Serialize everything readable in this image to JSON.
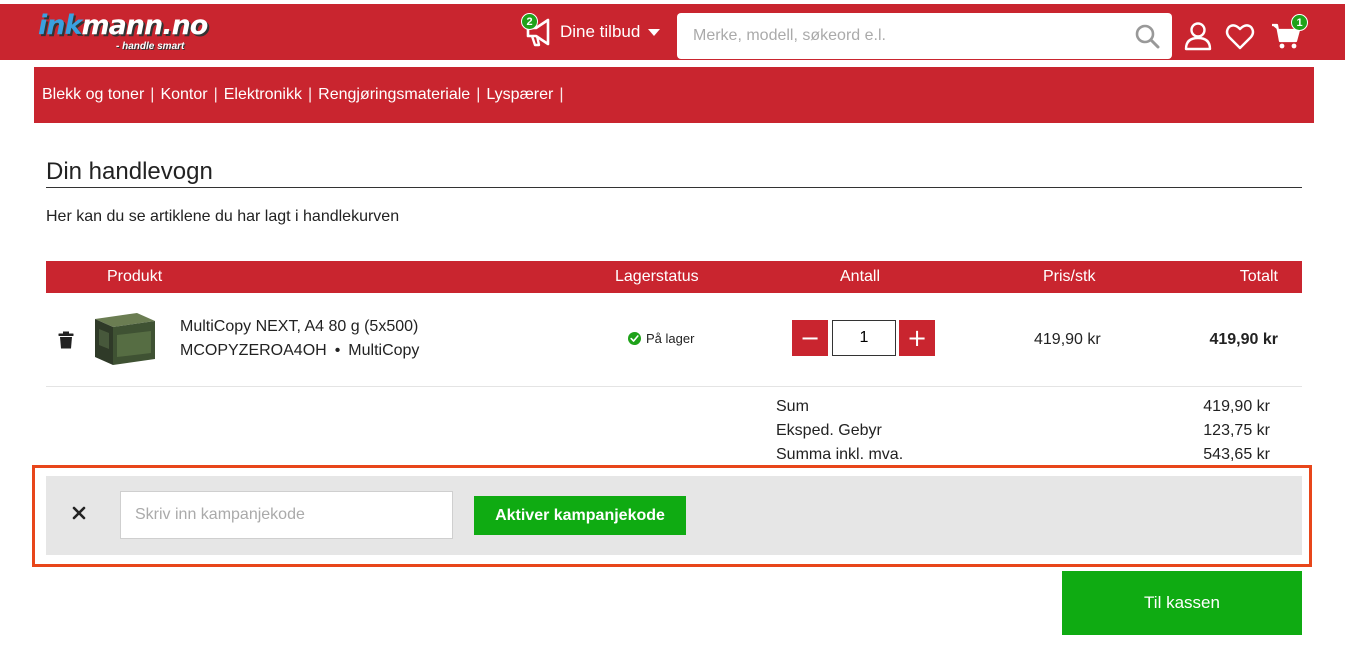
{
  "header": {
    "logo": {
      "ink": "ink",
      "rest": "mann.no",
      "tagline": "- handle smart"
    },
    "offers": {
      "label": "Dine tilbud",
      "count": "2"
    },
    "search": {
      "placeholder": "Merke, modell, søkeord e.l."
    },
    "cart_count": "1",
    "icons": [
      "megaphone-icon",
      "chevron-down-icon",
      "search-icon",
      "user-icon",
      "heart-icon",
      "cart-icon"
    ]
  },
  "nav": {
    "items": [
      {
        "label": "Blekk og toner"
      },
      {
        "label": "Kontor"
      },
      {
        "label": "Elektronikk"
      },
      {
        "label": "Rengjøringsmateriale"
      },
      {
        "label": "Lyspærer"
      }
    ],
    "separator": "|"
  },
  "page": {
    "title": "Din handlevogn",
    "intro": "Her kan du se artiklene du har lagt i handlekurven"
  },
  "table": {
    "headers": {
      "product": "Produkt",
      "stock": "Lagerstatus",
      "quantity": "Antall",
      "unit_price": "Pris/stk",
      "total": "Totalt"
    },
    "rows": [
      {
        "name": "MultiCopy NEXT, A4 80 g (5x500)",
        "sku": "MCOPYZEROA4OH",
        "brand": "MultiCopy",
        "stock": "På lager",
        "quantity": "1",
        "unit_price": "419,90 kr",
        "total": "419,90 kr"
      }
    ],
    "meta_separator": "•",
    "minus": "−",
    "plus": "+"
  },
  "summary": [
    {
      "label": "Sum",
      "value": "419,90 kr"
    },
    {
      "label": "Eksped. Gebyr",
      "value": "123,75 kr"
    },
    {
      "label": "Summa inkl. mva.",
      "value": "543,65 kr"
    }
  ],
  "campaign": {
    "placeholder": "Skriv inn kampanjekode",
    "button": "Aktiver kampanjekode"
  },
  "checkout": {
    "label": "Til kassen"
  },
  "colors": {
    "brand_red": "#c9252f",
    "action_green": "#0fab12",
    "badge_green": "#1fa21a",
    "highlight": "#e8461a"
  }
}
